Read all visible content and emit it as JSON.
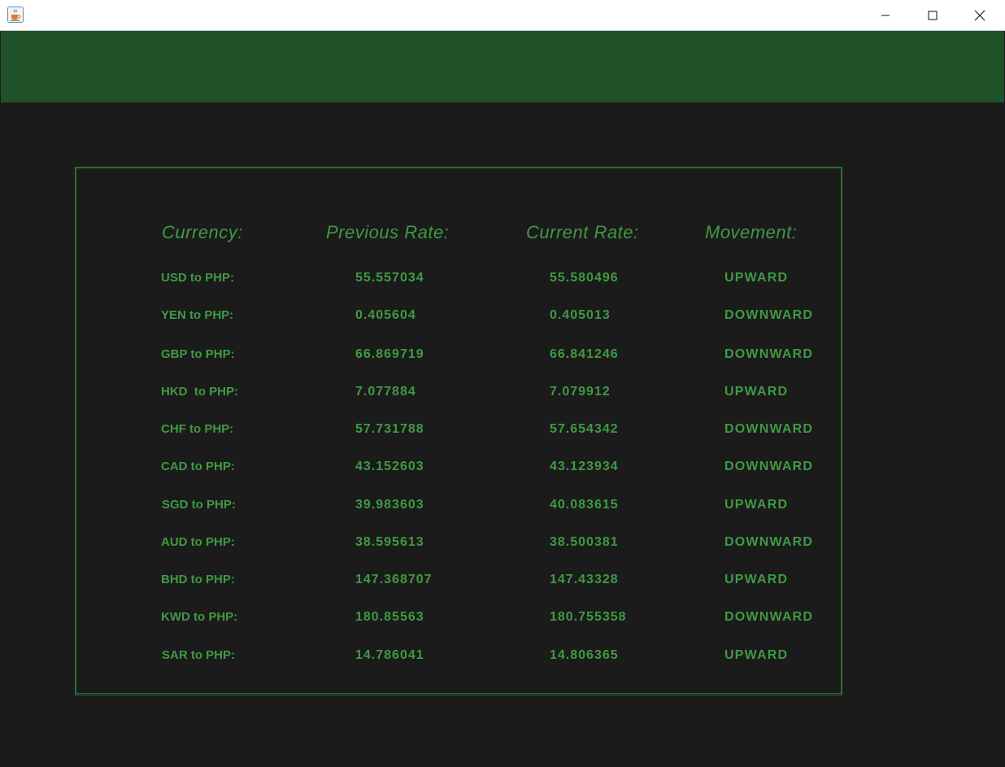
{
  "headers": {
    "currency": "Currency:",
    "previous": "Previous Rate:",
    "current": "Current Rate:",
    "movement": "Movement:"
  },
  "rows": [
    {
      "pair": "USD to PHP:",
      "previous": "55.557034",
      "current": "55.580496",
      "movement": "UPWARD"
    },
    {
      "pair": "YEN to PHP:",
      "previous": "0.405604",
      "current": "0.405013",
      "movement": "DOWNWARD"
    },
    {
      "pair": "GBP to PHP:",
      "previous": "66.869719",
      "current": "66.841246",
      "movement": "DOWNWARD"
    },
    {
      "pair": "HKD  to PHP:",
      "previous": "7.077884",
      "current": "7.079912",
      "movement": "UPWARD"
    },
    {
      "pair": "CHF to PHP:",
      "previous": "57.731788",
      "current": "57.654342",
      "movement": "DOWNWARD"
    },
    {
      "pair": "CAD to PHP:",
      "previous": "43.152603",
      "current": "43.123934",
      "movement": "DOWNWARD"
    },
    {
      "pair": "SGD to PHP:",
      "previous": "39.983603",
      "current": "40.083615",
      "movement": "UPWARD"
    },
    {
      "pair": "AUD to PHP:",
      "previous": "38.595613",
      "current": "38.500381",
      "movement": "DOWNWARD"
    },
    {
      "pair": "BHD to PHP:",
      "previous": "147.368707",
      "current": "147.43328",
      "movement": "UPWARD"
    },
    {
      "pair": "KWD to PHP:",
      "previous": "180.85563",
      "current": "180.755358",
      "movement": "DOWNWARD"
    },
    {
      "pair": "SAR to PHP:",
      "previous": "14.786041",
      "current": "14.806365",
      "movement": "UPWARD"
    }
  ],
  "icons": {
    "app": "java-coffee-icon",
    "minimize": "minimize-icon",
    "maximize": "maximize-icon",
    "close": "close-icon"
  },
  "colors": {
    "accent": "#3f9a43",
    "header_band": "#1f5229",
    "background": "#1b1b1b"
  }
}
